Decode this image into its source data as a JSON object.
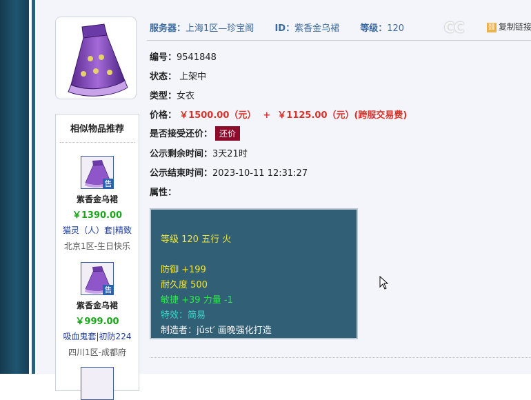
{
  "header": {
    "server_label": "服务器：",
    "server_value": "上海1区—珍宝阁",
    "id_label": "ID：",
    "id_value": "紫香金乌裙",
    "level_label": "等级：",
    "level_value": "120",
    "watermark_text": "CC",
    "watermark_link": "复制链接"
  },
  "details": {
    "serial_label": "编号：",
    "serial_value": "9541848",
    "status_label": "状态：",
    "status_value": "上架中",
    "type_label": "类型：",
    "type_value": "女衣",
    "price_label": "价格：",
    "price_value": "￥1500.00（元）",
    "price_plus": "+",
    "price_extra": "￥1125.00（元）(跨服交易费)",
    "bargain_label": "是否接受还价：",
    "bargain_button": "还价",
    "remaining_label": "公示剩余时间：",
    "remaining_value": "3天21时",
    "end_label": "公示结束时间：",
    "end_value": "2023-10-11 12:31:27",
    "attr_label": "属性："
  },
  "attributes": {
    "level_line": "等级 120 五行 火",
    "defense": "防御 +199",
    "durability": "耐久度 500",
    "agility": "敏捷 +39 力量 -1",
    "special": "特效：简易",
    "maker": "制造者：jǔst′ 画晚强化打造"
  },
  "similar": {
    "title": "相似物品推荐",
    "items": [
      {
        "name": "紫香金乌裙",
        "price": "￥1390.00",
        "attr": "猫灵（人）套|精致",
        "server": "北京1区-生日快乐",
        "badge": "售"
      },
      {
        "name": "紫香金乌裙",
        "price": "￥999.00",
        "attr": "吸血鬼套|初防224",
        "server": "四川1区-成都府",
        "badge": "售"
      }
    ]
  },
  "colors": {
    "price_red": "#d9322a",
    "bargain_button": "#8e0b2c",
    "attr_panel_bg": "#315f75",
    "similar_price_green": "#1aa51a"
  }
}
